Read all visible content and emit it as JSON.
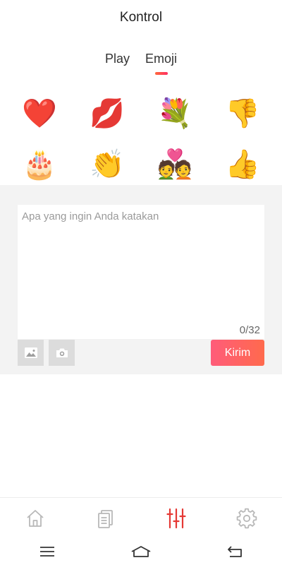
{
  "header": {
    "title": "Kontrol"
  },
  "tabs": [
    {
      "label": "Play",
      "active": false
    },
    {
      "label": "Emoji",
      "active": true
    }
  ],
  "emojis": [
    {
      "icon": "heart-icon",
      "glyph": "❤️"
    },
    {
      "icon": "lips-icon",
      "glyph": "💋"
    },
    {
      "icon": "bouquet-icon",
      "glyph": "💐"
    },
    {
      "icon": "thumbs-down-icon",
      "glyph": "👎"
    },
    {
      "icon": "birthday-cake-icon",
      "glyph": "🎂"
    },
    {
      "icon": "clapping-hands-icon",
      "glyph": "👏"
    },
    {
      "icon": "couple-with-heart-icon",
      "glyph": "💑"
    },
    {
      "icon": "thumbs-up-icon",
      "glyph": "👍"
    }
  ],
  "compose": {
    "placeholder": "Apa yang ingin Anda katakan",
    "value": "",
    "counter": "0/32",
    "send_label": "Kirim"
  },
  "colors": {
    "accent": "#ff5c7a",
    "nav_active": "#e53935",
    "nav_inactive": "#b8b8b8"
  },
  "nav": [
    {
      "icon": "home-icon",
      "active": false
    },
    {
      "icon": "documents-icon",
      "active": false
    },
    {
      "icon": "control-sliders-icon",
      "active": true
    },
    {
      "icon": "settings-gear-icon",
      "active": false
    }
  ],
  "system_nav": [
    {
      "icon": "menu-icon"
    },
    {
      "icon": "home-outline-icon"
    },
    {
      "icon": "back-icon"
    }
  ]
}
